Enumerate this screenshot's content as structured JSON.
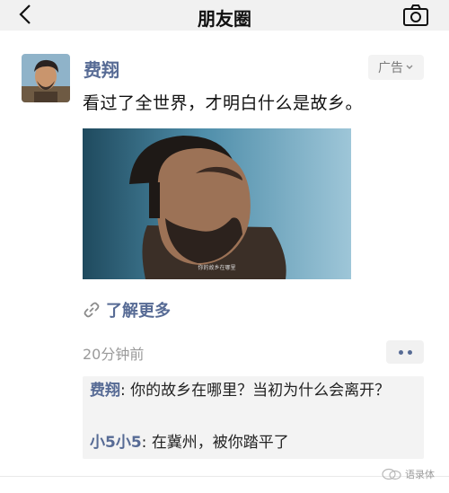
{
  "header": {
    "title": "朋友圈",
    "back_icon": "chevron-left-icon",
    "camera_icon": "camera-icon"
  },
  "post": {
    "author": "费翔",
    "ad_label": "广告",
    "text": "看过了全世界，才明白什么是故乡。",
    "image_caption": "你的故乡在哪里",
    "learn_more": "了解更多",
    "timestamp": "20分钟前"
  },
  "comments": [
    {
      "name": "费翔",
      "separator": ": ",
      "text": "你的故乡在哪里？当初为什么会离开？"
    },
    {
      "name": "小5小5",
      "separator": ": ",
      "text": "在冀州，被你踏平了"
    }
  ],
  "watermark": {
    "text": "语录体"
  },
  "colors": {
    "link": "#576b95",
    "topbar": "#f1f1f1",
    "comment_bg": "#f3f3f3"
  }
}
